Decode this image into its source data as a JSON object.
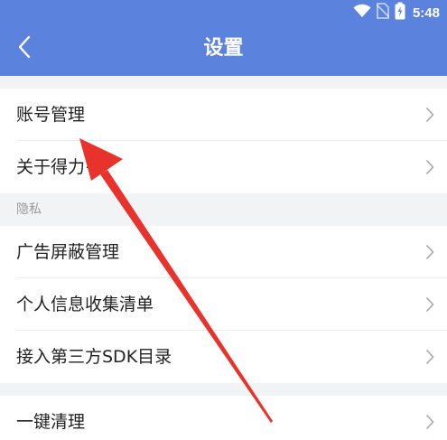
{
  "status_bar": {
    "time": "5:48",
    "icons": [
      "wifi-icon",
      "no-sim-icon",
      "battery-charging-icon"
    ]
  },
  "header": {
    "title": "设置",
    "back_icon": "chevron-left-icon",
    "background_color": "#5b82dd"
  },
  "sections": [
    {
      "items": [
        {
          "label": "账号管理"
        },
        {
          "label": "关于得力+"
        }
      ]
    },
    {
      "header": "隐私",
      "items": [
        {
          "label": "广告屏蔽管理"
        },
        {
          "label": "个人信息收集清单"
        },
        {
          "label": "接入第三方SDK目录"
        }
      ]
    },
    {
      "items": [
        {
          "label": "一键清理"
        }
      ]
    }
  ],
  "annotation": {
    "type": "red-arrow",
    "color": "#e8322c",
    "points_to": "账号管理"
  }
}
